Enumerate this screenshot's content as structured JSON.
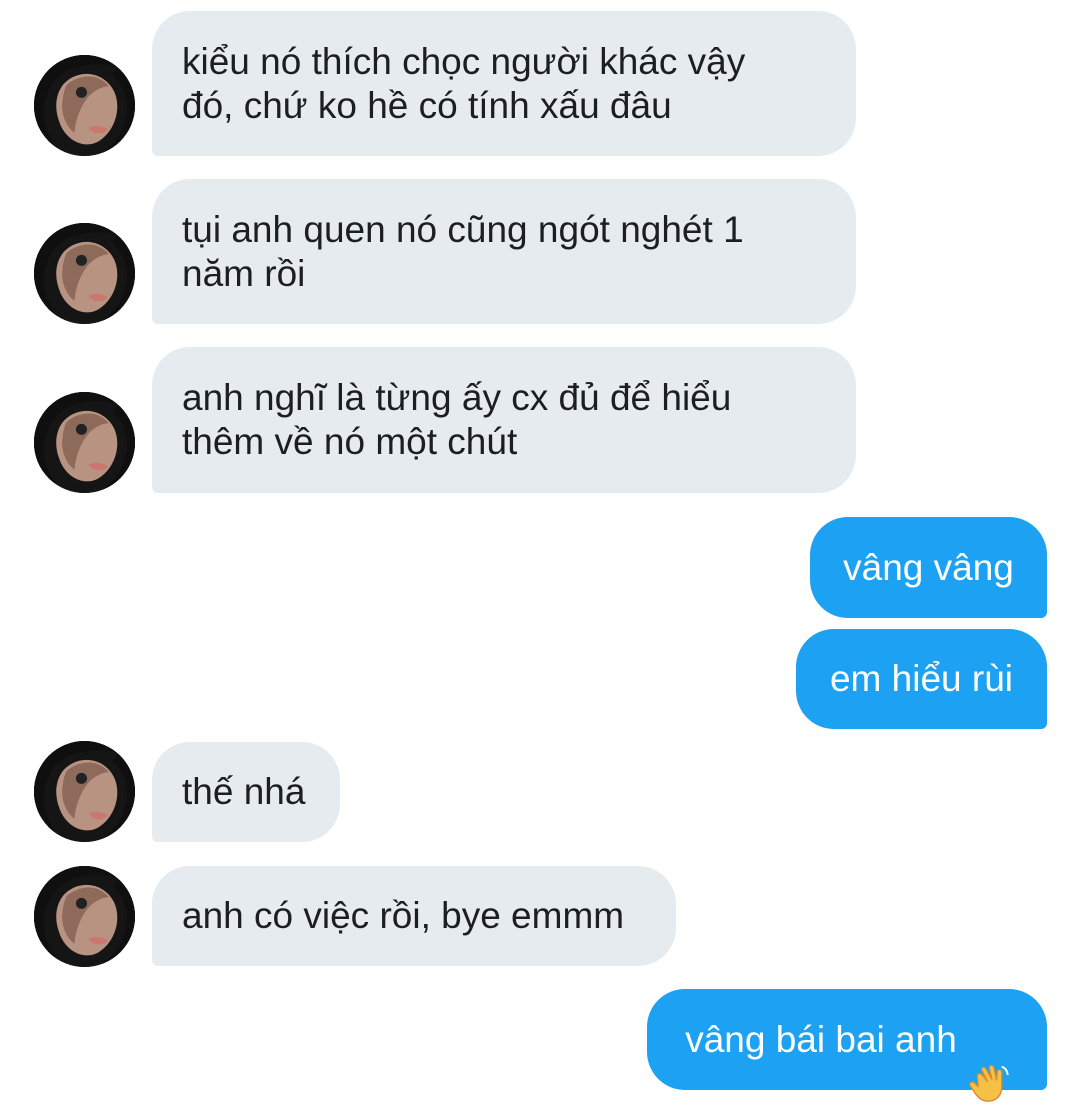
{
  "messages": [
    {
      "side": "in",
      "text": "kiểu nó thích chọc người khác vậy\nđó, chứ ko hề có tính xấu đâu"
    },
    {
      "side": "in",
      "text": "tụi anh quen nó cũng ngót nghét 1\nnăm rồi"
    },
    {
      "side": "in",
      "text": "anh nghĩ là từng ấy cx đủ để hiểu\nthêm về nó một chút"
    },
    {
      "side": "out",
      "text": "vâng vâng"
    },
    {
      "side": "out",
      "text": "em hiểu rùi"
    },
    {
      "side": "in",
      "text": "thế nhá"
    },
    {
      "side": "in",
      "text": "anh có việc rồi, bye emmm"
    },
    {
      "side": "out",
      "text": "vâng bái bai anh",
      "icon": "waving-hand-icon"
    }
  ],
  "colors": {
    "incoming_bubble": "#e6ebf0",
    "incoming_text": "#1b1f23",
    "outgoing_bubble": "#1da1f2",
    "outgoing_text": "#ffffff"
  }
}
